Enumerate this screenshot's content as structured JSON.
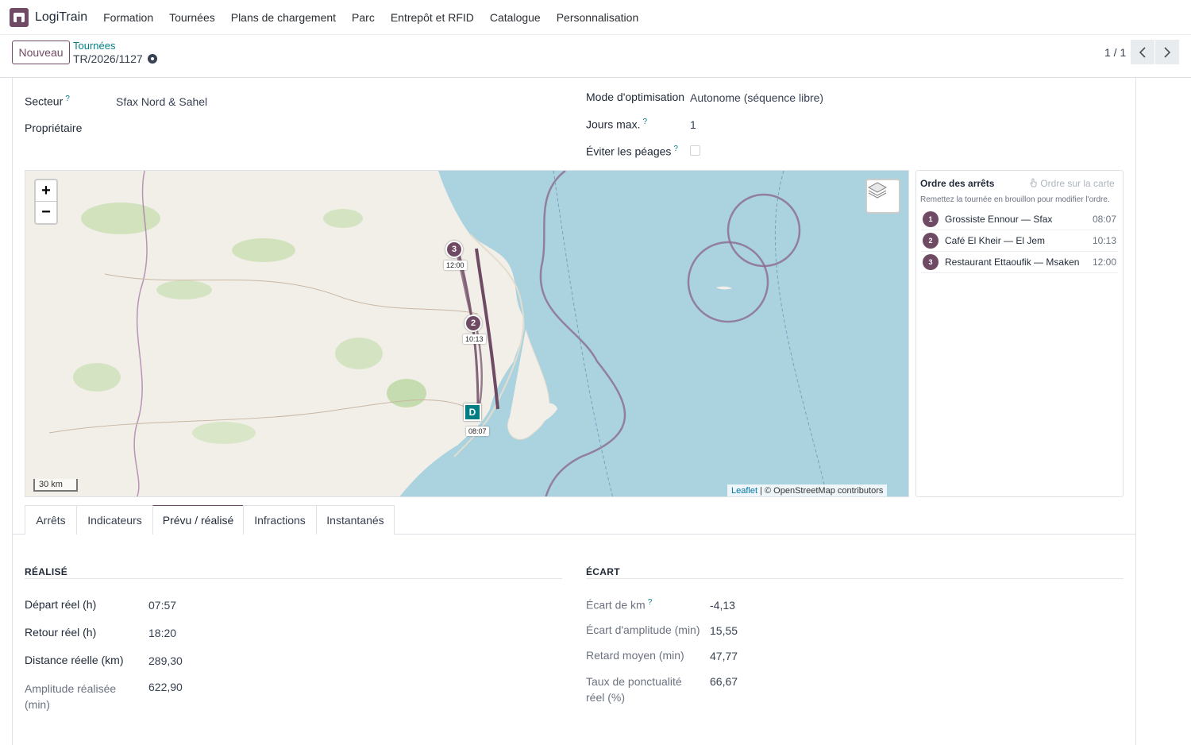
{
  "app": {
    "name": "LogiTrain"
  },
  "menu": [
    "Formation",
    "Tournées",
    "Plans de chargement",
    "Parc",
    "Entrepôt et RFID",
    "Catalogue",
    "Personnalisation"
  ],
  "control_panel": {
    "new_button": "Nouveau",
    "breadcrumb_parent": "Tournées",
    "record_name": "TR/2026/1127",
    "pager": "1 / 1"
  },
  "form": {
    "sector_label": "Secteur",
    "sector_help": "?",
    "sector_value": "Sfax Nord & Sahel",
    "owner_label": "Propriétaire",
    "optimization_label": "Mode d'optimisation",
    "optimization_value": "Autonome (séquence libre)",
    "max_days_label": "Jours max.",
    "max_days_help": "?",
    "max_days_value": "1",
    "avoid_tolls_label": "Éviter les péages",
    "avoid_tolls_help": "?",
    "avoid_tolls_checked": false
  },
  "map": {
    "zoom_in": "+",
    "zoom_out": "−",
    "scale": "30 km",
    "attribution_leaflet": "Leaflet",
    "attribution_rest": "| © OpenStreetMap contributors",
    "depot_label": "D",
    "depot_time": "08:07",
    "markers": [
      {
        "num": "2",
        "time": "10:13"
      },
      {
        "num": "3",
        "time": "12:00"
      }
    ],
    "route_color": "#6f4a63",
    "depot_color": "#017e84"
  },
  "stops_panel": {
    "title": "Ordre des arrêts",
    "action": "Ordre sur la carte",
    "hint": "Remettez la tournée en brouillon pour modifier l'ordre.",
    "stops": [
      {
        "num": "1",
        "name": "Grossiste Ennour — Sfax",
        "time": "08:07"
      },
      {
        "num": "2",
        "name": "Café El Kheir — El Jem",
        "time": "10:13"
      },
      {
        "num": "3",
        "name": "Restaurant Ettaoufik — Msaken",
        "time": "12:00"
      }
    ]
  },
  "tabs": [
    "Arrêts",
    "Indicateurs",
    "Prévu / réalisé",
    "Infractions",
    "Instantanés"
  ],
  "active_tab": "Prévu / réalisé",
  "realise": {
    "title": "RÉALISÉ",
    "rows": [
      {
        "label": "Départ réel (h)",
        "value": "07:57"
      },
      {
        "label": "Retour réel (h)",
        "value": "18:20"
      },
      {
        "label": "Distance réelle (km)",
        "value": "289,30"
      },
      {
        "label": "Amplitude réalisée (min)",
        "value": "622,90"
      }
    ]
  },
  "ecart": {
    "title": "ÉCART",
    "rows": [
      {
        "label": "Écart de km",
        "help": "?",
        "value": "-4,13"
      },
      {
        "label": "Écart d'amplitude (min)",
        "value": "15,55"
      },
      {
        "label": "Retard moyen (min)",
        "value": "47,77"
      },
      {
        "label": "Taux de ponctualité réel (%)",
        "value": "66,67"
      }
    ]
  },
  "colors": {
    "brand": "#714b67",
    "link": "#017e84",
    "sea": "#aad3df",
    "land": "#f2efe9"
  }
}
